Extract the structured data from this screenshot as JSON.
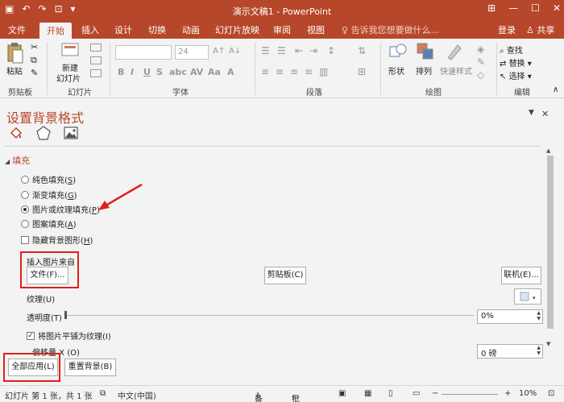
{
  "window": {
    "title": "演示文稿1 - PowerPoint"
  },
  "tabs": [
    {
      "label": "文件"
    },
    {
      "label": "开始"
    },
    {
      "label": "插入"
    },
    {
      "label": "设计"
    },
    {
      "label": "切换"
    },
    {
      "label": "动画"
    },
    {
      "label": "幻灯片放映"
    },
    {
      "label": "审阅"
    },
    {
      "label": "视图"
    }
  ],
  "tell_me": "告诉我您想要做什么...",
  "login": "登录",
  "share": "共享",
  "ribbon": {
    "paste": "粘贴",
    "new_slide_1": "新建",
    "new_slide_2": "幻灯片",
    "font_size": "24",
    "shape": "形状",
    "arrange": "排列",
    "quick_style": "快速样式",
    "find": "查找",
    "replace": "替换",
    "select": "选择",
    "groups": {
      "clipboard": "剪贴板",
      "slides": "幻灯片",
      "font": "字体",
      "paragraph": "段落",
      "drawing": "绘图",
      "editing": "编辑"
    }
  },
  "pane": {
    "title": "设置背景格式",
    "section": "填充",
    "options": [
      {
        "text": "纯色填充(",
        "key": "S",
        "end": ")"
      },
      {
        "text": "渐变填充(",
        "key": "G",
        "end": ")"
      },
      {
        "text": "图片或纹理填充(",
        "key": "P",
        "end": ")"
      },
      {
        "text": "图案填充(",
        "key": "A",
        "end": ")"
      }
    ],
    "hide_bg": {
      "text": "隐藏背景图形(",
      "key": "H",
      "end": ")"
    },
    "insert_from": "插入图片来自",
    "file_btn": "文件(F)...",
    "clipboard_btn": "剪贴板(C)",
    "online_btn": "联机(E)...",
    "texture_label": "纹理(U)",
    "transparency_label": "透明度(T)",
    "transparency_value": "0%",
    "tile_check": "将图片平铺为纹理(I)",
    "offset_x_label": "偏移量 X (O)",
    "offset_x_value": "0 磅",
    "apply_all": "全部应用(L)",
    "reset_bg": "重置背景(B)"
  },
  "status": {
    "slide": "幻灯片 第 1 张，共 1 张",
    "lang": "中文(中国)",
    "notes": "备注",
    "comments": "批注",
    "zoom": "10%"
  },
  "colors": {
    "accent": "#b7472a",
    "highlight": "#e0201b"
  }
}
